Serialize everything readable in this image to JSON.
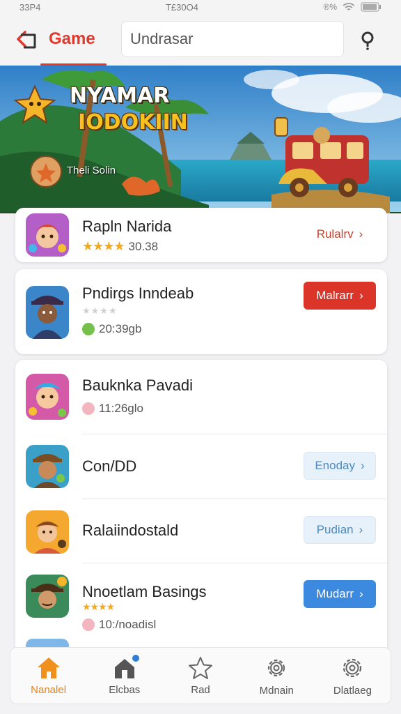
{
  "status": {
    "time": "33P4",
    "center": "T£30O4",
    "right": "®%"
  },
  "header": {
    "title": "Game",
    "search_value": "Undrasar"
  },
  "banner": {
    "title": "NYAMAR",
    "subtitle": "IODOKIIN",
    "caption": "Theli Solin"
  },
  "apps": [
    {
      "name": "Rapln Narida",
      "stars": "★★★★",
      "meta": "30.38",
      "action": "Rulalrv",
      "action_style": "plain"
    },
    {
      "name": "Pndirgs Inndeab",
      "stars": "★★★★",
      "meta": "20:39gb",
      "action": "Malrarr",
      "action_style": "red",
      "meta_dot": "#74c04b"
    },
    {
      "name": "Bauknka Pavadi",
      "meta": "11:26glo",
      "meta_dot": "#f3b6c0"
    },
    {
      "name": "Con/DD",
      "action": "Enoday",
      "action_style": "light"
    },
    {
      "name": "Ralaiindostald",
      "action": "Pudian",
      "action_style": "light"
    },
    {
      "name": "Nnoetlam Basings",
      "stars": "★★★★",
      "meta": "10:/noadisl",
      "action": "Mudarr",
      "action_style": "blue",
      "meta_dot": "#f3b6c0"
    }
  ],
  "nav": [
    {
      "label": "Nanalel",
      "icon": "home-icon",
      "active": true
    },
    {
      "label": "Elcbas",
      "icon": "store-icon"
    },
    {
      "label": "Rad",
      "icon": "star-icon"
    },
    {
      "label": "Mdnain",
      "icon": "gear-icon"
    },
    {
      "label": "Dlatlaeg",
      "icon": "settings-icon"
    }
  ],
  "colors": {
    "accent": "#e03a2f",
    "nav_active": "#e68416",
    "button_blue": "#3b8ae0"
  }
}
